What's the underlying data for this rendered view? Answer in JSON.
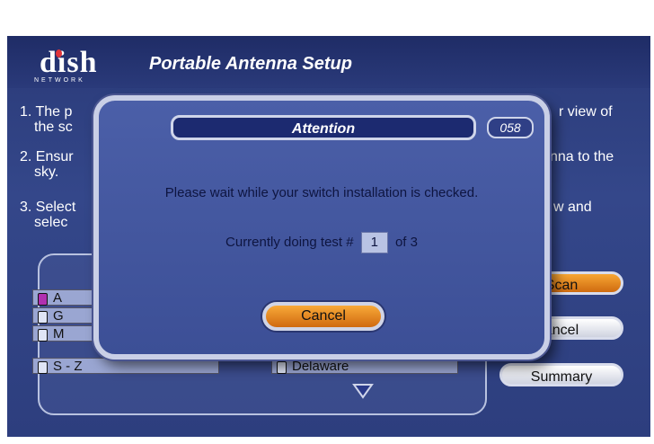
{
  "header": {
    "logo_text": "dish",
    "logo_sub": "NETWORK",
    "title": "Portable Antenna Setup"
  },
  "steps": [
    {
      "line1": "1. The p",
      "line2": "the sc",
      "right": "r view of"
    },
    {
      "line1": "2. Ensur",
      "line2": "sky.",
      "right": "nna to the"
    },
    {
      "line1": "3. Select",
      "line2": "selec",
      "right": "w and"
    }
  ],
  "list": {
    "rows": [
      {
        "label": "A",
        "checked": true
      },
      {
        "label": "G",
        "checked": false
      },
      {
        "label": "M",
        "checked": false
      },
      {
        "label": "S - Z",
        "checked": false
      }
    ],
    "state_item": "Delaware"
  },
  "side_buttons": {
    "scan": "Scan",
    "cancel": "ancel",
    "summary": "Summary"
  },
  "dialog": {
    "title": "Attention",
    "code": "058",
    "message": "Please wait while your switch installation is checked.",
    "test_prefix": "Currently doing test #",
    "test_current": "1",
    "test_of": "of",
    "test_total": "3",
    "cancel_label": "Cancel"
  },
  "colors": {
    "accent_orange": "#f39a2b",
    "background_blue": "#34478a",
    "check_selected": "#b030b0"
  }
}
